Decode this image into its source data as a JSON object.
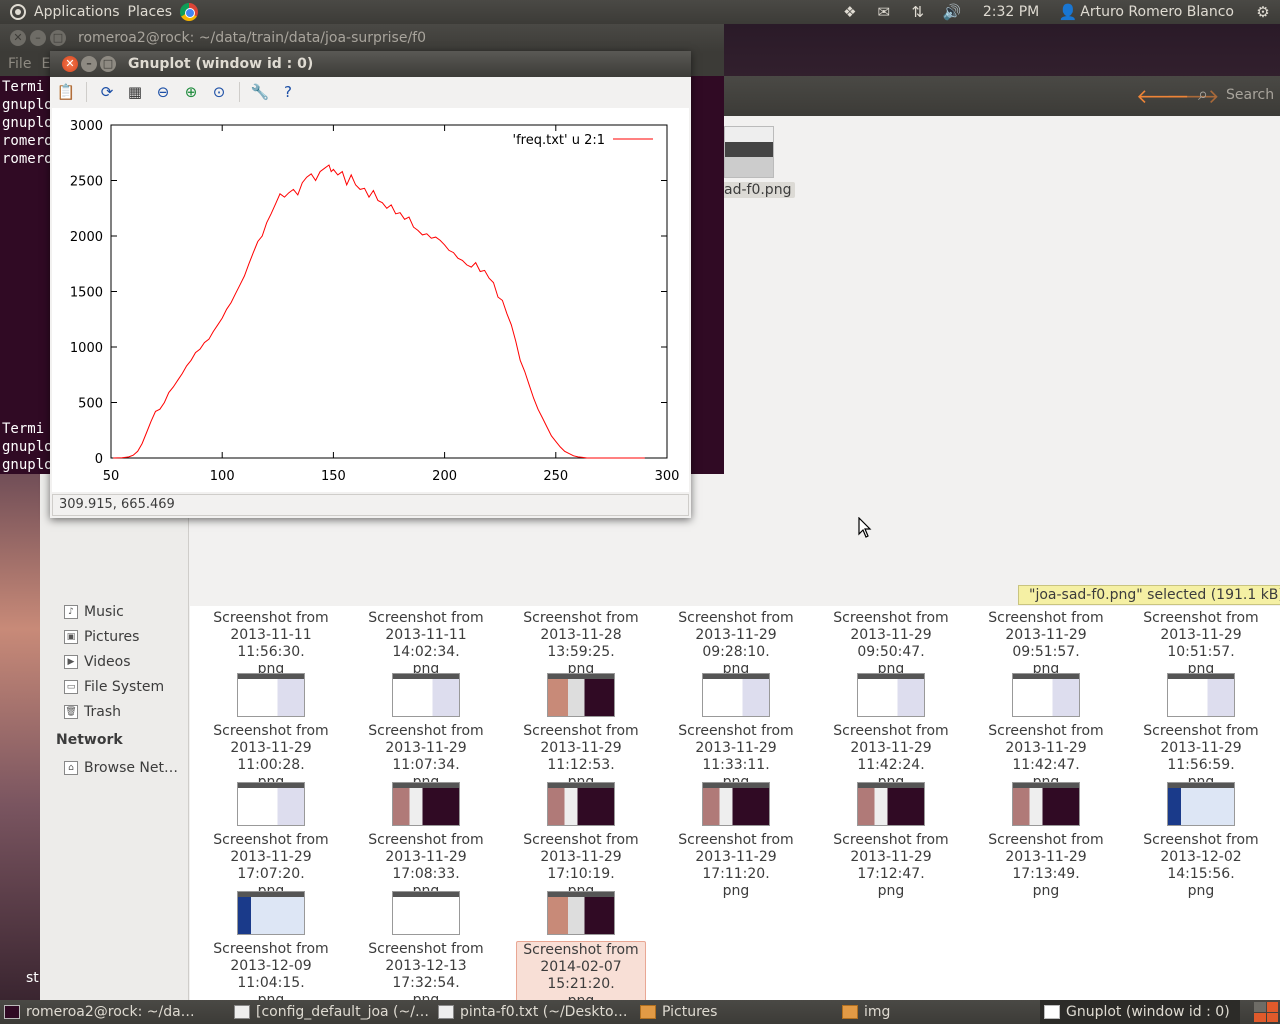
{
  "top_panel": {
    "applications": "Applications",
    "places": "Places",
    "clock": "2:32 PM",
    "user": "Arturo Romero Blanco"
  },
  "terminal": {
    "title": "romeroa2@rock: ~/data/train/data/joa-surprise/f0",
    "menu": [
      "File",
      "E"
    ],
    "lines_top": [
      "Termi",
      "gnuplo",
      "gnuplo",
      "romero",
      "romero"
    ],
    "lines_bottom": [
      "Termi",
      "gnuplo",
      "gnuplo"
    ]
  },
  "nautilus": {
    "search_label": "Search",
    "selected_file_name": "ad-f0.png",
    "sidebar": {
      "items": [
        "Music",
        "Pictures",
        "Videos",
        "File System",
        "Trash"
      ],
      "network_heading": "Network",
      "network_item": "Browse Net…"
    },
    "status_tooltip": "\"joa-sad-f0.png\" selected (191.1 kB)",
    "row0_labels": [
      "Screenshot from\n2013-11-11 11:56:30.\npng",
      "Screenshot from\n2013-11-11 14:02:34.\npng",
      "Screenshot from\n2013-11-28 13:59:25.\npng",
      "Screenshot from\n2013-11-29 09:28:10.\npng",
      "Screenshot from\n2013-11-29 09:50:47.\npng",
      "Screenshot from\n2013-11-29 09:51:57.\npng",
      "Screenshot from\n2013-11-29 10:51:57.\npng"
    ],
    "row1_labels": [
      "Screenshot from\n2013-11-29 11:00:28.\npng",
      "Screenshot from\n2013-11-29 11:07:34.\npng",
      "Screenshot from\n2013-11-29 11:12:53.\npng",
      "Screenshot from\n2013-11-29 11:33:11.\npng",
      "Screenshot from\n2013-11-29 11:42:24.\npng",
      "Screenshot from\n2013-11-29 11:42:47.\npng",
      "Screenshot from\n2013-11-29 11:56:59.\npng"
    ],
    "row2_labels": [
      "Screenshot from\n2013-11-29 17:07:20.\npng",
      "Screenshot from\n2013-11-29 17:08:33.\npng",
      "Screenshot from\n2013-11-29 17:10:19.\npng",
      "Screenshot from\n2013-11-29 17:11:20.\npng",
      "Screenshot from\n2013-11-29 17:12:47.\npng",
      "Screenshot from\n2013-11-29 17:13:49.\npng",
      "Screenshot from\n2013-12-02 14:15:56.\npng"
    ],
    "row3_labels": [
      "Screenshot from\n2013-12-09 11:04:15.\npng",
      "Screenshot from\n2013-12-13 17:32:54.\npng",
      "Screenshot from\n2014-02-07 15:21:20.\npng"
    ]
  },
  "gnuplot": {
    "title": "Gnuplot (window id : 0)",
    "toolbar_icons": [
      "copy-clipboard-icon",
      "replot-icon",
      "grid-icon",
      "zoom-previous-icon",
      "zoom-next-icon",
      "autoscale-icon",
      "config-icon",
      "help-icon"
    ],
    "status": "309.915,  665.469"
  },
  "chart_data": {
    "type": "line",
    "series": [
      {
        "name": "'freq.txt' u 2:1",
        "color": "#ff0000",
        "x": [
          51,
          55,
          58,
          60,
          62,
          64,
          66,
          68,
          70,
          72,
          74,
          76,
          78,
          80,
          82,
          84,
          86,
          88,
          90,
          92,
          94,
          96,
          98,
          100,
          102,
          104,
          106,
          108,
          110,
          112,
          114,
          116,
          118,
          120,
          122,
          124,
          126,
          128,
          130,
          132,
          134,
          136,
          138,
          140,
          142,
          144,
          146,
          148,
          149,
          150,
          152,
          154,
          156,
          158,
          160,
          162,
          164,
          166,
          168,
          170,
          172,
          174,
          176,
          178,
          180,
          182,
          184,
          186,
          188,
          190,
          192,
          194,
          196,
          198,
          200,
          202,
          204,
          206,
          208,
          210,
          212,
          214,
          216,
          218,
          220,
          222,
          224,
          226,
          228,
          230,
          232,
          234,
          236,
          238,
          240,
          242,
          244,
          246,
          248,
          250,
          252,
          254,
          256,
          258,
          260,
          262,
          264,
          266,
          268,
          270,
          272,
          274,
          276,
          278,
          280,
          285,
          290
        ],
        "y": [
          0,
          2,
          10,
          25,
          60,
          130,
          230,
          330,
          420,
          440,
          500,
          590,
          640,
          700,
          760,
          830,
          880,
          950,
          980,
          1040,
          1070,
          1140,
          1200,
          1260,
          1340,
          1400,
          1480,
          1560,
          1640,
          1750,
          1850,
          1950,
          2000,
          2120,
          2200,
          2290,
          2380,
          2350,
          2390,
          2420,
          2370,
          2480,
          2530,
          2560,
          2500,
          2580,
          2610,
          2640,
          2580,
          2600,
          2550,
          2580,
          2460,
          2550,
          2460,
          2420,
          2430,
          2350,
          2410,
          2320,
          2300,
          2250,
          2280,
          2200,
          2210,
          2150,
          2170,
          2080,
          2050,
          2010,
          2020,
          1980,
          1990,
          1960,
          1920,
          1870,
          1850,
          1800,
          1780,
          1740,
          1720,
          1760,
          1680,
          1690,
          1620,
          1580,
          1450,
          1420,
          1300,
          1200,
          1050,
          880,
          780,
          660,
          540,
          440,
          360,
          280,
          200,
          150,
          100,
          60,
          40,
          20,
          10,
          5,
          0,
          0,
          0,
          0,
          0,
          0,
          0,
          0,
          0,
          0,
          0
        ],
        "title": "'freq.txt' u 2:1"
      }
    ],
    "xlim": [
      50,
      300
    ],
    "ylim": [
      0,
      3000
    ],
    "xticks": [
      50,
      100,
      150,
      200,
      250,
      300
    ],
    "yticks": [
      0,
      500,
      1000,
      1500,
      2000,
      2500,
      3000
    ],
    "legend": "top-right",
    "grid": false,
    "xlabel": "",
    "ylabel": ""
  },
  "taskbar": {
    "tasks": [
      "romeroa2@rock: ~/da…",
      "[config_default_joa (~/…",
      "pinta-f0.txt (~/Deskto…",
      "Pictures",
      "img",
      "Gnuplot (window id : 0)"
    ]
  },
  "desktop": {
    "partial_text": "st"
  }
}
